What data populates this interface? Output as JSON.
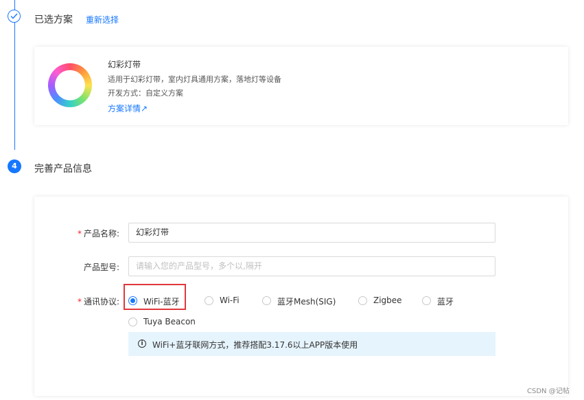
{
  "steps": {
    "selected_title": "已选方案",
    "reselect_label": "重新选择",
    "step_number": "4",
    "info_title": "完善产品信息"
  },
  "plan": {
    "name": "幻彩灯带",
    "description": "适用于幻彩灯带，室内灯具通用方案，落地灯等设备",
    "dev_mode": "开发方式：自定义方案",
    "detail_link": "方案详情↗"
  },
  "form": {
    "product_name_label": "产品名称:",
    "product_name_value": "幻彩灯带",
    "product_model_label": "产品型号:",
    "product_model_placeholder": "请输入您的产品型号，多个以,隔开",
    "protocol_label": "通讯协议:",
    "required_mark": "*",
    "protocols": [
      {
        "label": "WiFi-蓝牙",
        "checked": true
      },
      {
        "label": "Wi-Fi",
        "checked": false
      },
      {
        "label": "蓝牙Mesh(SIG)",
        "checked": false
      },
      {
        "label": "Zigbee",
        "checked": false
      },
      {
        "label": "蓝牙",
        "checked": false
      },
      {
        "label": "Tuya Beacon",
        "checked": false
      }
    ],
    "info_icon": "i",
    "info_text": "WiFi+蓝牙联网方式，推荐搭配3.17.6以上APP版本使用"
  },
  "watermark": "CSDN @记帖",
  "colors": {
    "accent": "#1677ff",
    "required": "#f5222d",
    "highlight": "#e0373b",
    "info_bg": "#e6f4fd"
  }
}
